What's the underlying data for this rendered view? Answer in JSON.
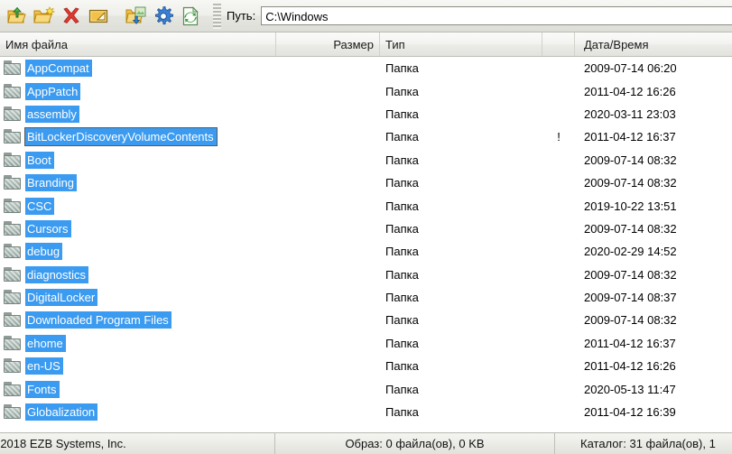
{
  "toolbar": {
    "buttons": [
      {
        "name": "extract-icon",
        "title": "Извлечь"
      },
      {
        "name": "new-folder-icon",
        "title": "Новая папка"
      },
      {
        "name": "delete-icon",
        "title": "Удалить"
      },
      {
        "name": "rename-icon",
        "title": "Переименовать"
      },
      {
        "name": "add-files-icon",
        "title": "Добавить файлы"
      },
      {
        "name": "settings-gear-icon",
        "title": "Настройки"
      },
      {
        "name": "refresh-icon",
        "title": "Обновить"
      }
    ],
    "path_label": "Путь:",
    "path_value": "C:\\Windows",
    "path_placeholder": "C:\\"
  },
  "columns": [
    {
      "key": "name",
      "label": "Имя файла",
      "align": "left"
    },
    {
      "key": "size",
      "label": "Размер",
      "align": "right"
    },
    {
      "key": "type",
      "label": "Тип",
      "align": "left"
    },
    {
      "key": "flag",
      "label": "",
      "align": "center"
    },
    {
      "key": "date",
      "label": "Дата/Время",
      "align": "left"
    }
  ],
  "rows": [
    {
      "name": "AppCompat",
      "size": "",
      "type": "Папка",
      "flag": "",
      "date": "2009-07-14 06:20",
      "selected": true,
      "focused": false
    },
    {
      "name": "AppPatch",
      "size": "",
      "type": "Папка",
      "flag": "",
      "date": "2011-04-12 16:26",
      "selected": true,
      "focused": false
    },
    {
      "name": "assembly",
      "size": "",
      "type": "Папка",
      "flag": "",
      "date": "2020-03-11 23:03",
      "selected": true,
      "focused": false
    },
    {
      "name": "BitLockerDiscoveryVolumeContents",
      "size": "",
      "type": "Папка",
      "flag": "!",
      "date": "2011-04-12 16:37",
      "selected": true,
      "focused": true
    },
    {
      "name": "Boot",
      "size": "",
      "type": "Папка",
      "flag": "",
      "date": "2009-07-14 08:32",
      "selected": true,
      "focused": false
    },
    {
      "name": "Branding",
      "size": "",
      "type": "Папка",
      "flag": "",
      "date": "2009-07-14 08:32",
      "selected": true,
      "focused": false
    },
    {
      "name": "CSC",
      "size": "",
      "type": "Папка",
      "flag": "",
      "date": "2019-10-22 13:51",
      "selected": true,
      "focused": false
    },
    {
      "name": "Cursors",
      "size": "",
      "type": "Папка",
      "flag": "",
      "date": "2009-07-14 08:32",
      "selected": true,
      "focused": false
    },
    {
      "name": "debug",
      "size": "",
      "type": "Папка",
      "flag": "",
      "date": "2020-02-29 14:52",
      "selected": true,
      "focused": false
    },
    {
      "name": "diagnostics",
      "size": "",
      "type": "Папка",
      "flag": "",
      "date": "2009-07-14 08:32",
      "selected": true,
      "focused": false
    },
    {
      "name": "DigitalLocker",
      "size": "",
      "type": "Папка",
      "flag": "",
      "date": "2009-07-14 08:37",
      "selected": true,
      "focused": false
    },
    {
      "name": "Downloaded Program Files",
      "size": "",
      "type": "Папка",
      "flag": "",
      "date": "2009-07-14 08:32",
      "selected": true,
      "focused": false
    },
    {
      "name": "ehome",
      "size": "",
      "type": "Папка",
      "flag": "",
      "date": "2011-04-12 16:37",
      "selected": true,
      "focused": false
    },
    {
      "name": "en-US",
      "size": "",
      "type": "Папка",
      "flag": "",
      "date": "2011-04-12 16:26",
      "selected": true,
      "focused": false
    },
    {
      "name": "Fonts",
      "size": "",
      "type": "Папка",
      "flag": "",
      "date": "2020-05-13 11:47",
      "selected": true,
      "focused": false
    },
    {
      "name": "Globalization",
      "size": "",
      "type": "Папка",
      "flag": "",
      "date": "2011-04-12 16:39",
      "selected": true,
      "focused": false
    }
  ],
  "statusbar": {
    "copyright": "-2018 EZB Systems, Inc.",
    "image_info": "Образ: 0 файла(ов), 0 KB",
    "folder_info": "Каталог: 31 файла(ов), 1"
  },
  "colors": {
    "selection_blue": "#3b9bf0",
    "focus_border": "#5a5a5a",
    "window_bg": "#ffffff",
    "chrome_bg": "#ececE7"
  }
}
